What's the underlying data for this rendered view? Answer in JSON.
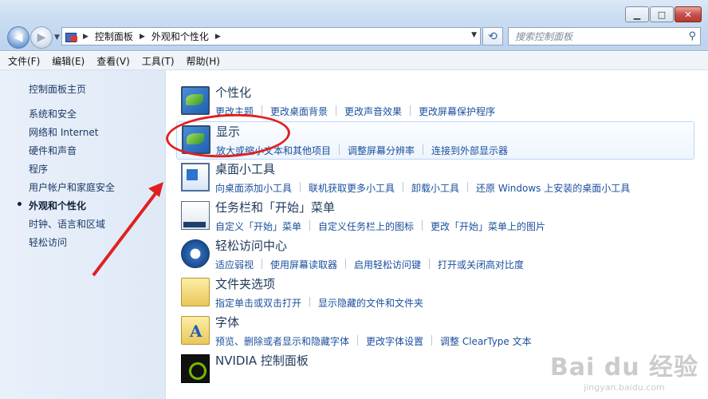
{
  "window": {
    "minimize": "▁",
    "maximize": "□",
    "close": "✕"
  },
  "address_bar": {
    "crumbs": [
      "控制面板",
      "外观和个性化"
    ]
  },
  "search": {
    "placeholder": "搜索控制面板"
  },
  "menu": [
    "文件(F)",
    "编辑(E)",
    "查看(V)",
    "工具(T)",
    "帮助(H)"
  ],
  "sidebar": {
    "home": "控制面板主页",
    "items": [
      {
        "label": "系统和安全",
        "active": false
      },
      {
        "label": "网络和 Internet",
        "active": false
      },
      {
        "label": "硬件和声音",
        "active": false
      },
      {
        "label": "程序",
        "active": false
      },
      {
        "label": "用户帐户和家庭安全",
        "active": false
      },
      {
        "label": "外观和个性化",
        "active": true
      },
      {
        "label": "时钟、语言和区域",
        "active": false
      },
      {
        "label": "轻松访问",
        "active": false
      }
    ]
  },
  "categories": [
    {
      "icon": "personalization-icon",
      "title": "个性化",
      "highlighted": false,
      "links": [
        "更改主题",
        "更改桌面背景",
        "更改声音效果",
        "更改屏幕保护程序"
      ]
    },
    {
      "icon": "display-icon",
      "title": "显示",
      "highlighted": true,
      "links": [
        "放大或缩小文本和其他项目",
        "调整屏幕分辨率",
        "连接到外部显示器"
      ]
    },
    {
      "icon": "desktop-gadgets-icon",
      "title": "桌面小工具",
      "highlighted": false,
      "links": [
        "向桌面添加小工具",
        "联机获取更多小工具",
        "卸载小工具",
        "还原 Windows 上安装的桌面小工具"
      ]
    },
    {
      "icon": "taskbar-icon",
      "title": "任务栏和「开始」菜单",
      "highlighted": false,
      "links": [
        "自定义「开始」菜单",
        "自定义任务栏上的图标",
        "更改「开始」菜单上的图片"
      ]
    },
    {
      "icon": "ease-of-access-icon",
      "title": "轻松访问中心",
      "highlighted": false,
      "links": [
        "适应弱视",
        "使用屏幕读取器",
        "启用轻松访问键",
        "打开或关闭高对比度"
      ]
    },
    {
      "icon": "folder-options-icon",
      "title": "文件夹选项",
      "highlighted": false,
      "links": [
        "指定单击或双击打开",
        "显示隐藏的文件和文件夹"
      ]
    },
    {
      "icon": "fonts-icon",
      "title": "字体",
      "highlighted": false,
      "links": [
        "预览、删除或者显示和隐藏字体",
        "更改字体设置",
        "调整 ClearType 文本"
      ]
    },
    {
      "icon": "nvidia-icon",
      "title": "NVIDIA 控制面板",
      "highlighted": false,
      "links": []
    }
  ],
  "watermark": {
    "logo": "Bai du 经验",
    "url": "jingyan.baidu.com"
  },
  "colors": {
    "annotation": "#e02020",
    "link": "#1a4f9c",
    "title": "#1e395b"
  }
}
